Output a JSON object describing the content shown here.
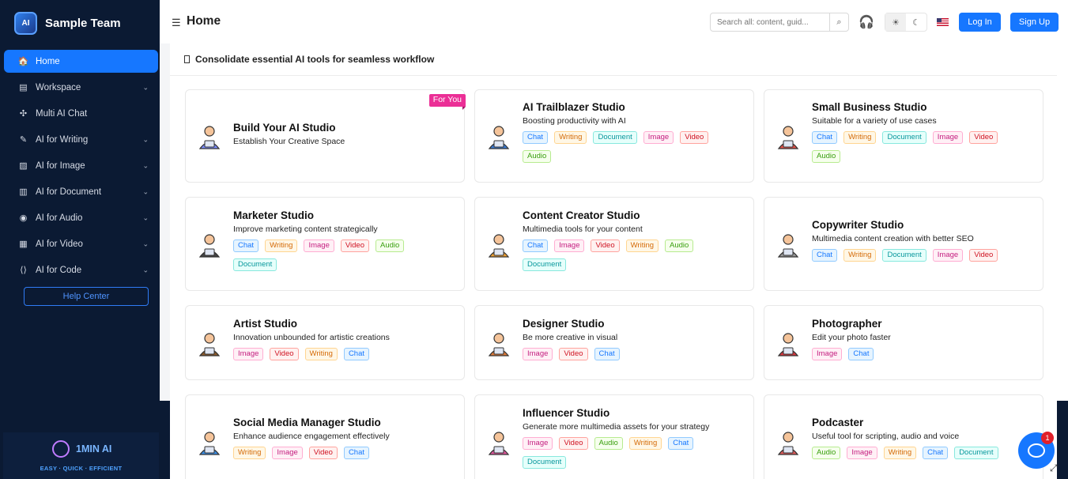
{
  "sidebar": {
    "team_name": "Sample Team",
    "logo_text": "AI",
    "items": [
      {
        "label": "Home",
        "icon": "home-icon",
        "active": true,
        "has_chevron": false,
        "glyph": "🏠"
      },
      {
        "label": "Workspace",
        "icon": "workspace-icon",
        "active": false,
        "has_chevron": true,
        "glyph": "▤"
      },
      {
        "label": "Multi AI Chat",
        "icon": "multi-chat-icon",
        "active": false,
        "has_chevron": false,
        "glyph": "✣"
      },
      {
        "label": "AI for Writing",
        "icon": "writing-icon",
        "active": false,
        "has_chevron": true,
        "glyph": "✎"
      },
      {
        "label": "AI for Image",
        "icon": "image-icon",
        "active": false,
        "has_chevron": true,
        "glyph": "▨"
      },
      {
        "label": "AI for Document",
        "icon": "document-icon",
        "active": false,
        "has_chevron": true,
        "glyph": "▥"
      },
      {
        "label": "AI for Audio",
        "icon": "audio-icon",
        "active": false,
        "has_chevron": true,
        "glyph": "◉"
      },
      {
        "label": "AI for Video",
        "icon": "video-icon",
        "active": false,
        "has_chevron": true,
        "glyph": "▦"
      },
      {
        "label": "AI for Code",
        "icon": "code-icon",
        "active": false,
        "has_chevron": true,
        "glyph": "⟨⟩"
      }
    ],
    "help_center": "Help Center",
    "promo_title": "1MIN AI",
    "promo_subtitle": "EASY · QUICK · EFFICIENT"
  },
  "header": {
    "title": "Home",
    "search_placeholder": "Search all: content, guid...",
    "login_label": "Log In",
    "signup_label": "Sign Up"
  },
  "main": {
    "heading": "Consolidate essential AI tools for seamless workflow",
    "cards": [
      {
        "title": "Build Your AI Studio",
        "desc": "Establish Your Creative Space",
        "tags": [],
        "ribbon": "For You",
        "illus_color": "#7b8cff"
      },
      {
        "title": "AI Trailblazer Studio",
        "desc": "Boosting productivity with AI",
        "tags": [
          "Chat",
          "Writing",
          "Document",
          "Image",
          "Video",
          "Audio"
        ],
        "ribbon": "",
        "illus_color": "#3a7bd5"
      },
      {
        "title": "Small Business Studio",
        "desc": "Suitable for a variety of use cases",
        "tags": [
          "Chat",
          "Writing",
          "Document",
          "Image",
          "Video",
          "Audio"
        ],
        "ribbon": "",
        "illus_color": "#e5534b"
      },
      {
        "title": "Marketer Studio",
        "desc": "Improve marketing content strategically",
        "tags": [
          "Chat",
          "Writing",
          "Image",
          "Video",
          "Audio",
          "Document"
        ],
        "ribbon": "",
        "illus_color": "#444"
      },
      {
        "title": "Content Creator Studio",
        "desc": "Multimedia tools for your content",
        "tags": [
          "Chat",
          "Image",
          "Video",
          "Writing",
          "Audio",
          "Document"
        ],
        "ribbon": "",
        "illus_color": "#f0a030"
      },
      {
        "title": "Copywriter Studio",
        "desc": "Multimedia content creation with better SEO",
        "tags": [
          "Chat",
          "Writing",
          "Document",
          "Image",
          "Video"
        ],
        "ribbon": "",
        "illus_color": "#999"
      },
      {
        "title": "Artist Studio",
        "desc": "Innovation unbounded for artistic creations",
        "tags": [
          "Image",
          "Video",
          "Writing",
          "Chat"
        ],
        "ribbon": "",
        "illus_color": "#8b5a2b"
      },
      {
        "title": "Designer Studio",
        "desc": "Be more creative in visual",
        "tags": [
          "Image",
          "Video",
          "Chat"
        ],
        "ribbon": "",
        "illus_color": "#e07b39"
      },
      {
        "title": "Photographer",
        "desc": "Edit your photo faster",
        "tags": [
          "Image",
          "Chat"
        ],
        "ribbon": "",
        "illus_color": "#d9363e"
      },
      {
        "title": "Social Media Manager Studio",
        "desc": "Enhance audience engagement effectively",
        "tags": [
          "Writing",
          "Image",
          "Video",
          "Chat"
        ],
        "ribbon": "",
        "illus_color": "#3a8ee6"
      },
      {
        "title": "Influencer Studio",
        "desc": "Generate more multimedia assets for your strategy",
        "tags": [
          "Image",
          "Video",
          "Audio",
          "Writing",
          "Chat",
          "Document"
        ],
        "ribbon": "",
        "illus_color": "#e0559c"
      },
      {
        "title": "Podcaster",
        "desc": "Useful tool for scripting, audio and voice",
        "tags": [
          "Audio",
          "Image",
          "Writing",
          "Chat",
          "Document"
        ],
        "ribbon": "",
        "illus_color": "#e05a5a"
      }
    ]
  },
  "chat_widget": {
    "badge": "1"
  }
}
